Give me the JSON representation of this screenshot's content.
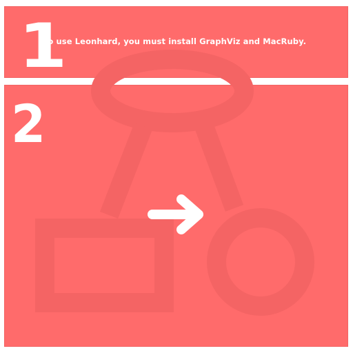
{
  "steps": [
    {
      "number": "1",
      "text": "To use Leonhard, you must install GraphViz and MacRuby."
    },
    {
      "number": "2"
    }
  ],
  "icons": {
    "background": "graph-diagram-icon",
    "arrow": "right-arrow-icon"
  },
  "colors": {
    "panel": "#ff6b6b",
    "diagram": "#f46464",
    "text": "#ffffff"
  }
}
